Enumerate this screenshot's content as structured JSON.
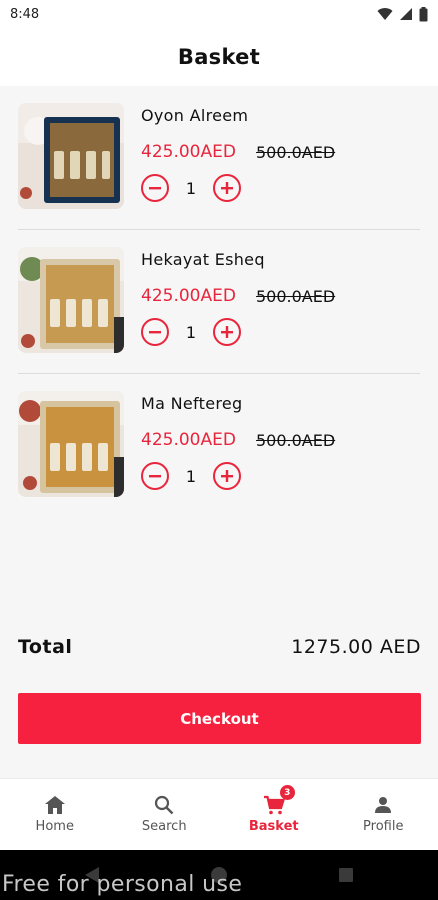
{
  "status_bar": {
    "time": "8:48"
  },
  "header": {
    "title": "Basket"
  },
  "items": [
    {
      "name": "Oyon Alreem",
      "price": "425.00AED",
      "old_price": "500.0AED",
      "qty": "1",
      "box_color": "#173250"
    },
    {
      "name": "Hekayat Esheq",
      "price": "425.00AED",
      "old_price": "500.0AED",
      "qty": "1",
      "box_color": "#d9c8a7"
    },
    {
      "name": "Ma Neftereg",
      "price": "425.00AED",
      "old_price": "500.0AED",
      "qty": "1",
      "box_color": "#d6c49e"
    }
  ],
  "total": {
    "label": "Total",
    "value": "1275.00 AED"
  },
  "checkout": {
    "label": "Checkout"
  },
  "nav": {
    "items": [
      {
        "label": "Home",
        "icon": "home-icon"
      },
      {
        "label": "Search",
        "icon": "search-icon"
      },
      {
        "label": "Basket",
        "icon": "cart-icon",
        "badge": "3"
      },
      {
        "label": "Profile",
        "icon": "person-icon"
      }
    ]
  },
  "watermark": "Free for personal use",
  "colors": {
    "accent": "#e8253c",
    "button": "#f5213f"
  }
}
